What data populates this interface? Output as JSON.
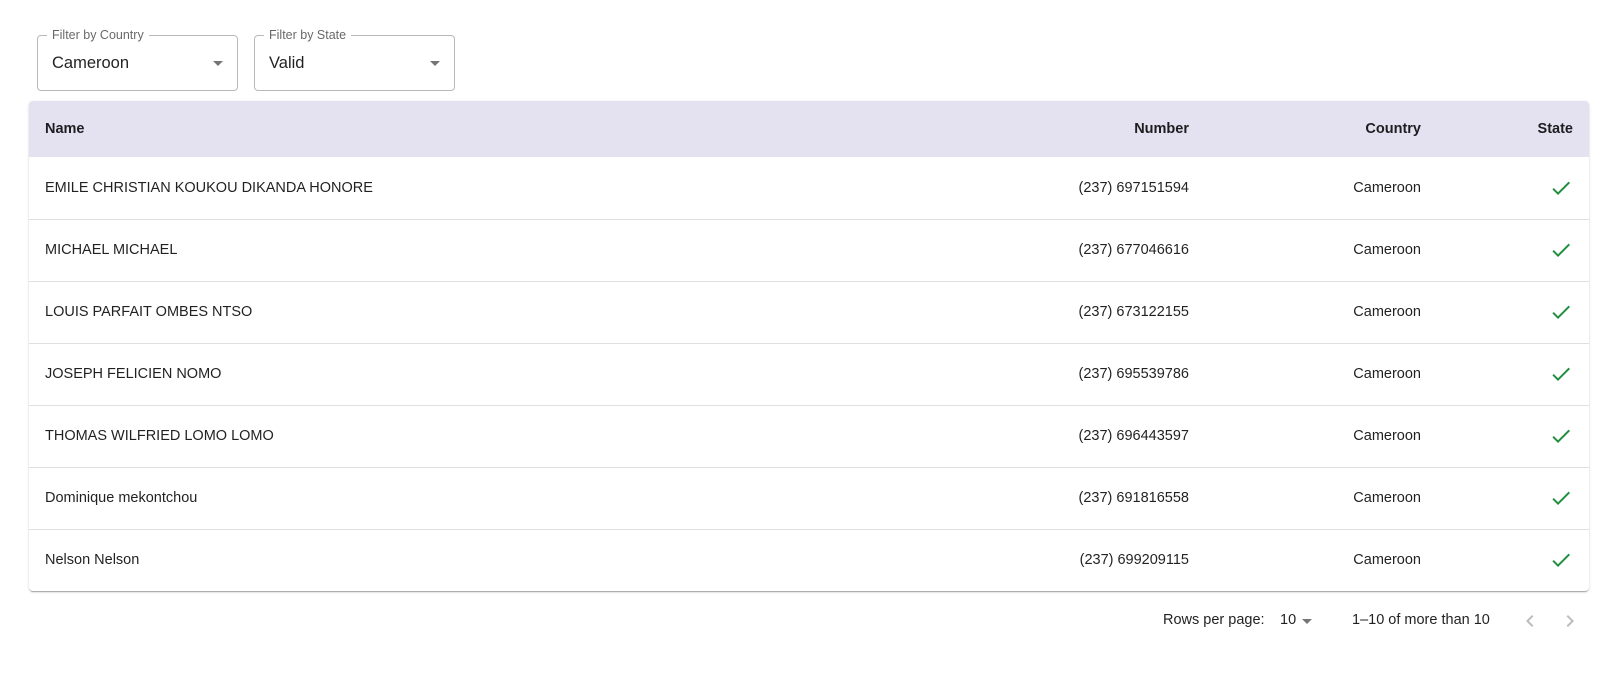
{
  "filters": {
    "country": {
      "label": "Filter by Country",
      "value": "Cameroon"
    },
    "state": {
      "label": "Filter by State",
      "value": "Valid"
    }
  },
  "table": {
    "headers": {
      "name": "Name",
      "number": "Number",
      "country": "Country",
      "state": "State"
    },
    "rows": [
      {
        "name": "EMILE CHRISTIAN KOUKOU DIKANDA HONORE",
        "number": "(237) 697151594",
        "country": "Cameroon",
        "state_icon": "check-icon"
      },
      {
        "name": "MICHAEL MICHAEL",
        "number": "(237) 677046616",
        "country": "Cameroon",
        "state_icon": "check-icon"
      },
      {
        "name": "LOUIS PARFAIT OMBES NTSO",
        "number": "(237) 673122155",
        "country": "Cameroon",
        "state_icon": "check-icon"
      },
      {
        "name": "JOSEPH FELICIEN NOMO",
        "number": "(237) 695539786",
        "country": "Cameroon",
        "state_icon": "check-icon"
      },
      {
        "name": "THOMAS WILFRIED LOMO LOMO",
        "number": "(237) 696443597",
        "country": "Cameroon",
        "state_icon": "check-icon"
      },
      {
        "name": "Dominique mekontchou",
        "number": "(237) 691816558",
        "country": "Cameroon",
        "state_icon": "check-icon"
      },
      {
        "name": "Nelson Nelson",
        "number": "(237) 699209115",
        "country": "Cameroon",
        "state_icon": "check-icon"
      }
    ]
  },
  "pagination": {
    "rows_per_page_label": "Rows per page:",
    "rows_per_page_value": "10",
    "range_text": "1–10 of more than 10",
    "prev_icon": "chevron-left-icon",
    "next_icon": "chevron-right-icon"
  },
  "colors": {
    "header_bg": "#e4e1f1",
    "valid_check": "#1e8e3e",
    "row_divider": "#e0e0e0"
  }
}
